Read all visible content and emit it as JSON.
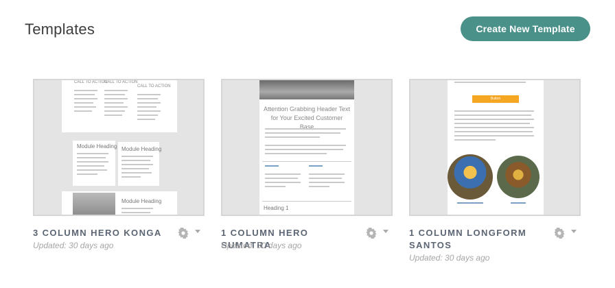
{
  "header": {
    "title": "Templates",
    "create_button": "Create New Template"
  },
  "templates": [
    {
      "name": "3 COLUMN HERO KONGA",
      "updated": "Updated: 30 days ago",
      "preview": {
        "cta": "CALL TO ACTION",
        "module_heading": "Module Heading"
      }
    },
    {
      "name": "1 COLUMN HERO SUMATRA",
      "updated": "Updated: 30 days ago",
      "preview": {
        "headline": "Attention Grabbing Header Text for Your Excited Customer Base",
        "heading": "Heading 1"
      }
    },
    {
      "name": "1 COLUMN LONGFORM SANTOS",
      "updated": "Updated: 30 days ago",
      "preview": {
        "button": "Button"
      }
    }
  ],
  "colors": {
    "accent": "#4a9189",
    "title_text": "#5b6573",
    "muted": "#a6a6a6",
    "preview_button": "#f5a623"
  }
}
